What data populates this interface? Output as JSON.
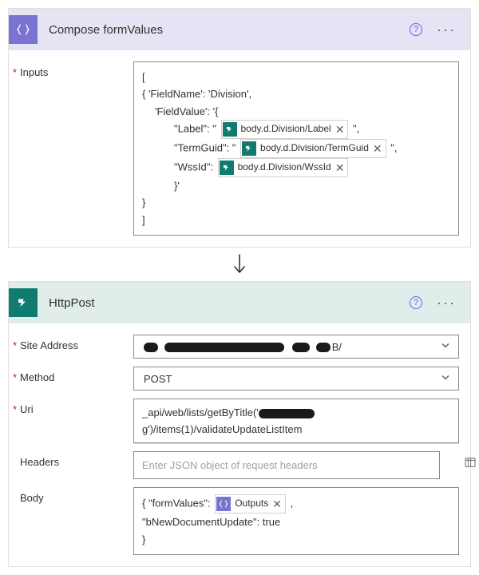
{
  "composeCard": {
    "title": "Compose formValues",
    "inputsLabel": "Inputs",
    "lines": {
      "open": "[",
      "obj": "{  'FieldName': 'Division',",
      "fv": "'FieldValue': '{",
      "labelKey": "\"Label\": \" ",
      "termKey": "\"TermGuid\": \" ",
      "wssKey": "\"WssId\": ",
      "qclose": " \",",
      "fvclose": "}'",
      "objclose": "}",
      "close": "]"
    },
    "tokens": {
      "label": "body.d.Division/Label",
      "termguid": "body.d.Division/TermGuid",
      "wssid": "body.d.Division/WssId"
    }
  },
  "httpCard": {
    "title": "HttpPost",
    "siteLabel": "Site Address",
    "siteValue": "B/",
    "methodLabel": "Method",
    "methodValue": "POST",
    "uriLabel": "Uri",
    "uriPrefix": "_api/web/lists/getByTitle('",
    "uriSuffix": "g')/items(1)/validateUpdateListItem",
    "headersLabel": "Headers",
    "headersPlaceholder": "Enter JSON object of request headers",
    "bodyLabel": "Body",
    "body": {
      "l1a": "{ \"formValues\": ",
      "l1b": " ,",
      "outputsToken": "Outputs",
      "l2": "\"bNewDocumentUpdate\": true",
      "l3": "}"
    }
  }
}
